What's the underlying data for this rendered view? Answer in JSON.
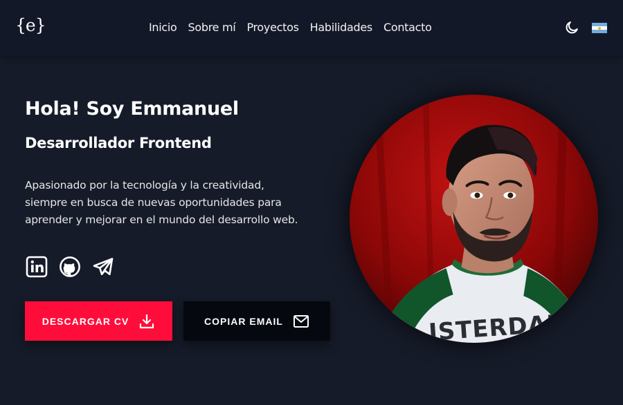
{
  "header": {
    "logo": "{e}",
    "nav": [
      {
        "label": "Inicio"
      },
      {
        "label": "Sobre mí"
      },
      {
        "label": "Proyectos"
      },
      {
        "label": "Habilidades"
      },
      {
        "label": "Contacto"
      }
    ],
    "theme_icon": "moon-icon",
    "language_icon": "argentina-flag-icon"
  },
  "hero": {
    "title": "Hola! Soy Emmanuel",
    "subtitle": "Desarrollador Frontend",
    "description_lines": [
      "Apasionado por la tecnología y la creatividad,",
      "siempre en busca de nuevas oportunidades para",
      "aprender y mejorar en el mundo del desarrollo web."
    ],
    "socials": [
      {
        "icon": "linkedin-icon"
      },
      {
        "icon": "github-icon"
      },
      {
        "icon": "telegram-icon"
      }
    ],
    "buttons": {
      "download_cv": "DESCARGAR CV",
      "copy_email": "COPIAR EMAIL"
    },
    "photo_shirt_text": "ISTERDAI"
  },
  "colors": {
    "background": "#161b29",
    "navbar": "#131828",
    "accent": "#ff0d3a",
    "dark_button": "#06080f",
    "flag_blue": "#74acdf",
    "flag_white": "#ffffff",
    "flag_sun": "#f6b40e"
  }
}
